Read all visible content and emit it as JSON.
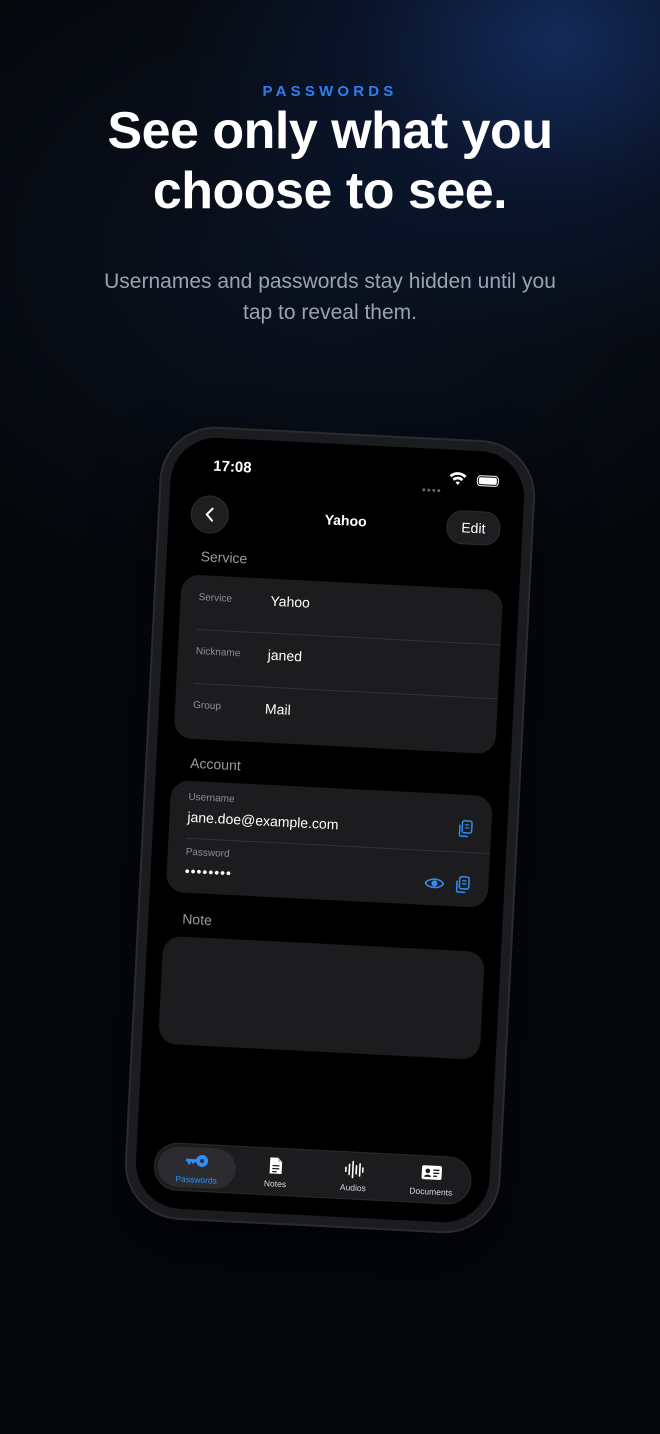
{
  "hero": {
    "eyebrow": "PASSWORDS",
    "headline_line1": "See only what you",
    "headline_line2": "choose to see.",
    "subtitle_line1": "Usernames and passwords stay hidden until you",
    "subtitle_line2": "tap to reveal them."
  },
  "status_bar": {
    "time": "17:08"
  },
  "nav": {
    "back_icon": "chevron-left-icon",
    "title": "Yahoo",
    "edit_label": "Edit"
  },
  "service_section": {
    "label": "Service",
    "rows": [
      {
        "label": "Service",
        "value": "Yahoo"
      },
      {
        "label": "Nickname",
        "value": "janed"
      },
      {
        "label": "Group",
        "value": "Mail"
      }
    ]
  },
  "account_section": {
    "label": "Account",
    "username_label": "Username",
    "username_value": "jane.doe@example.com",
    "password_label": "Password",
    "password_value": "••••••••"
  },
  "note_section": {
    "label": "Note",
    "value": ""
  },
  "tabbar": {
    "tabs": [
      {
        "label": "Passwords",
        "icon": "key-icon",
        "active": true
      },
      {
        "label": "Notes",
        "icon": "document-icon",
        "active": false
      },
      {
        "label": "Audios",
        "icon": "waveform-icon",
        "active": false
      },
      {
        "label": "Documents",
        "icon": "id-card-icon",
        "active": false
      }
    ]
  },
  "colors": {
    "accent": "#2f8ef5",
    "eyebrow": "#2f7ef0",
    "card_bg": "#1c1c1e"
  }
}
